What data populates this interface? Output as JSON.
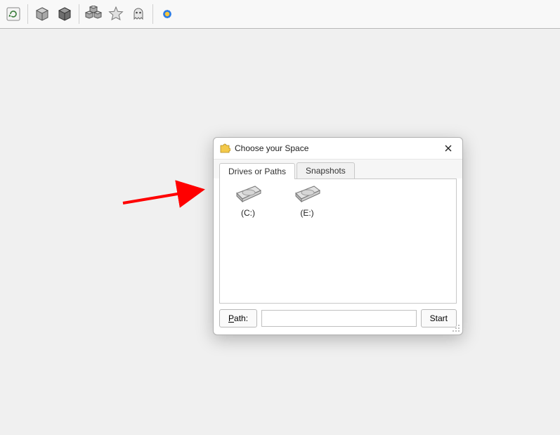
{
  "toolbar": {
    "icons": [
      "refresh-icon",
      "cube-icon",
      "cube-dark-icon",
      "cubes-icon",
      "star-icon",
      "ghost-icon",
      "flower-icon"
    ]
  },
  "dialog": {
    "title": "Choose your Space",
    "tabs": {
      "drives": "Drives or Paths",
      "snapshots": "Snapshots"
    },
    "drives": [
      {
        "label": "(C:)"
      },
      {
        "label": "(E:)"
      }
    ],
    "path_button": "Path:",
    "path_value": "",
    "start_button": "Start"
  }
}
